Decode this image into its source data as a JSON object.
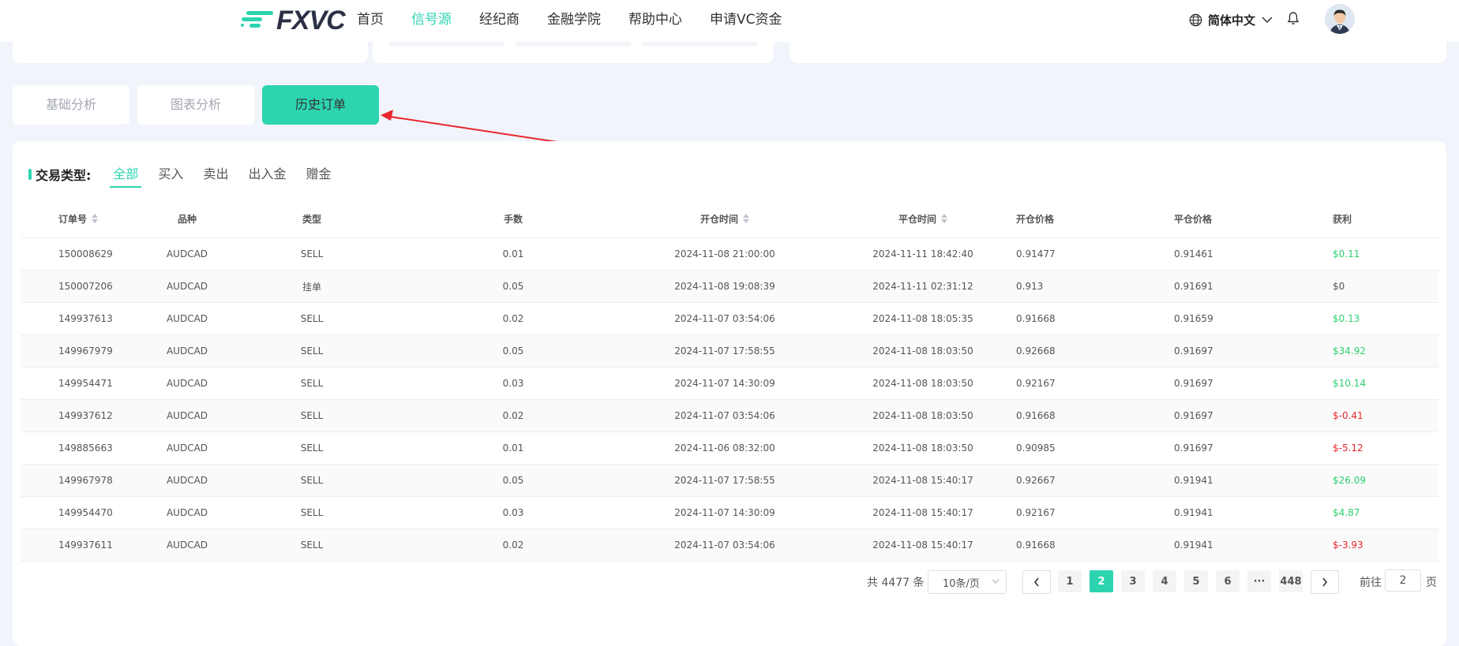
{
  "header": {
    "logo_text": "FXVC",
    "nav": [
      {
        "label": "首页",
        "active": false
      },
      {
        "label": "信号源",
        "active": true
      },
      {
        "label": "经纪商",
        "active": false
      },
      {
        "label": "金融学院",
        "active": false
      },
      {
        "label": "帮助中心",
        "active": false
      },
      {
        "label": "申请VC资金",
        "active": false
      }
    ],
    "language": "简体中文"
  },
  "tabs": [
    {
      "label": "基础分析",
      "active": false
    },
    {
      "label": "图表分析",
      "active": false
    },
    {
      "label": "历史订单",
      "active": true
    }
  ],
  "filter": {
    "label": "交易类型:",
    "options": [
      "全部",
      "买入",
      "卖出",
      "出入金",
      "赠金"
    ],
    "active_index": 0
  },
  "table": {
    "columns": [
      "订单号",
      "品种",
      "类型",
      "手数",
      "开仓时间",
      "平仓时间",
      "开仓价格",
      "平仓价格",
      "获利"
    ],
    "rows": [
      [
        "150008629",
        "AUDCAD",
        "SELL",
        "0.01",
        "2024-11-08 21:00:00",
        "2024-11-11 18:42:40",
        "0.91477",
        "0.91461",
        "$0.11"
      ],
      [
        "150007206",
        "AUDCAD",
        "挂单",
        "0.05",
        "2024-11-08 19:08:39",
        "2024-11-11 02:31:12",
        "0.913",
        "0.91691",
        "$0"
      ],
      [
        "149937613",
        "AUDCAD",
        "SELL",
        "0.02",
        "2024-11-07 03:54:06",
        "2024-11-08 18:05:35",
        "0.91668",
        "0.91659",
        "$0.13"
      ],
      [
        "149967979",
        "AUDCAD",
        "SELL",
        "0.05",
        "2024-11-07 17:58:55",
        "2024-11-08 18:03:50",
        "0.92668",
        "0.91697",
        "$34.92"
      ],
      [
        "149954471",
        "AUDCAD",
        "SELL",
        "0.03",
        "2024-11-07 14:30:09",
        "2024-11-08 18:03:50",
        "0.92167",
        "0.91697",
        "$10.14"
      ],
      [
        "149937612",
        "AUDCAD",
        "SELL",
        "0.02",
        "2024-11-07 03:54:06",
        "2024-11-08 18:03:50",
        "0.91668",
        "0.91697",
        "$-0.41"
      ],
      [
        "149885663",
        "AUDCAD",
        "SELL",
        "0.01",
        "2024-11-06 08:32:00",
        "2024-11-08 18:03:50",
        "0.90985",
        "0.91697",
        "$-5.12"
      ],
      [
        "149967978",
        "AUDCAD",
        "SELL",
        "0.05",
        "2024-11-07 17:58:55",
        "2024-11-08 15:40:17",
        "0.92667",
        "0.91941",
        "$26.09"
      ],
      [
        "149954470",
        "AUDCAD",
        "SELL",
        "0.03",
        "2024-11-07 14:30:09",
        "2024-11-08 15:40:17",
        "0.92167",
        "0.91941",
        "$4.87"
      ],
      [
        "149937611",
        "AUDCAD",
        "SELL",
        "0.02",
        "2024-11-07 03:54:06",
        "2024-11-08 15:40:17",
        "0.91668",
        "0.91941",
        "$-3.93"
      ]
    ]
  },
  "pagination": {
    "total_text": "共 4477 条",
    "page_size": "10条/页",
    "pages": [
      "1",
      "2",
      "3",
      "4",
      "5",
      "6",
      "···",
      "448"
    ],
    "current_page": "2",
    "goto_prefix": "前往",
    "goto_value": "2",
    "goto_suffix": "页"
  },
  "colors": {
    "accent": "#2dd4b0",
    "profit": "#2ecf70",
    "loss": "#e8262c",
    "annotation_arrow": "#e8262c"
  }
}
